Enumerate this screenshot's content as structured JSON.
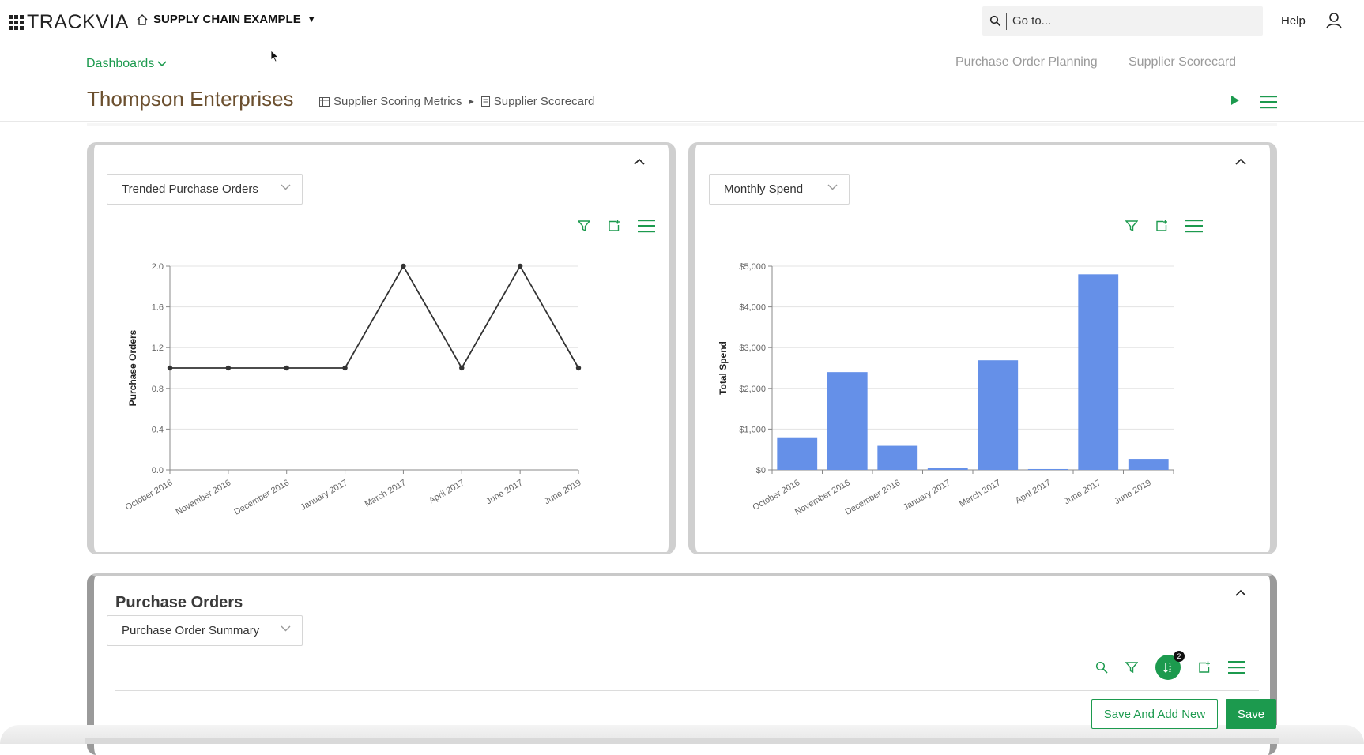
{
  "app": {
    "logo_text": "TRACKVIA",
    "app_name": "SUPPLY CHAIN EXAMPLE",
    "search_placeholder": "Go to...",
    "help_label": "Help"
  },
  "header": {
    "dashboards_label": "Dashboards",
    "nav": [
      "Purchase Order Planning",
      "Supplier Scorecard"
    ],
    "page_title": "Thompson Enterprises",
    "breadcrumbs": [
      "Supplier Scoring Metrics",
      "Supplier Scorecard"
    ]
  },
  "panels": {
    "left": {
      "selected": "Trended Purchase Orders"
    },
    "right": {
      "selected": "Monthly Spend"
    },
    "bottom": {
      "title": "Purchase Orders",
      "selected": "Purchase Order Summary",
      "sort_count": "2"
    }
  },
  "buttons": {
    "save_and_add_new": "Save And Add New",
    "save": "Save"
  },
  "colors": {
    "accent": "#1c9a4e",
    "bar": "#6590e8",
    "title": "#6b4f2e"
  },
  "chart_data": [
    {
      "type": "line",
      "categories": [
        "October 2016",
        "November 2016",
        "December 2016",
        "January 2017",
        "March 2017",
        "April 2017",
        "June 2017",
        "June 2019"
      ],
      "values": [
        1,
        1,
        1,
        1,
        2,
        1,
        2,
        1
      ],
      "xlabel": "",
      "ylabel": "Purchase Orders",
      "ylim": [
        0,
        2
      ],
      "yticks": [
        "0.0",
        "0.4",
        "0.8",
        "1.2",
        "1.6",
        "2.0"
      ],
      "grid": true
    },
    {
      "type": "bar",
      "categories": [
        "October 2016",
        "November 2016",
        "December 2016",
        "January 2017",
        "March 2017",
        "April 2017",
        "June 2017",
        "June 2019"
      ],
      "values": [
        800,
        2400,
        590,
        40,
        2690,
        20,
        4800,
        270
      ],
      "xlabel": "",
      "ylabel": "Total Spend",
      "ylim": [
        0,
        5000
      ],
      "yticks": [
        "$0",
        "$1,000",
        "$2,000",
        "$3,000",
        "$4,000",
        "$5,000"
      ],
      "grid": true
    }
  ]
}
